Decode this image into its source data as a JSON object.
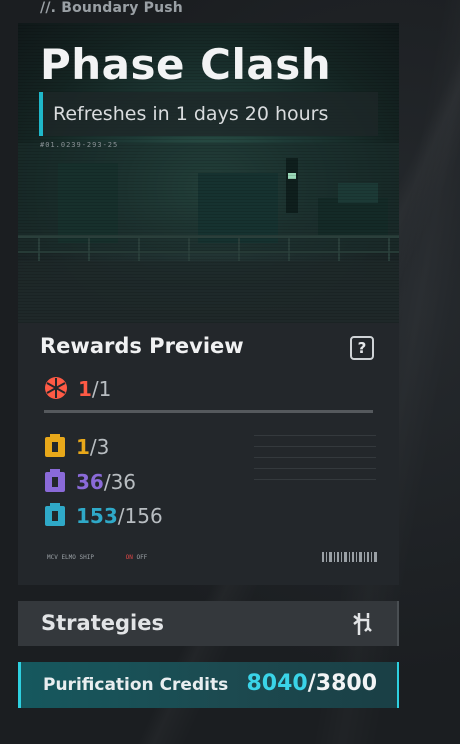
{
  "section_label": "//. Boundary Push",
  "event": {
    "title": "Phase Clash",
    "refresh_text": "Refreshes in 1 days 20 hours",
    "serial": "#01.0239-293-25"
  },
  "rewards": {
    "title": "Rewards Preview",
    "help_icon": "question-icon",
    "items": [
      {
        "icon": "orange-emblem-icon",
        "current": "1",
        "total": "/1",
        "color": "#ff5a45"
      },
      {
        "icon": "gold-chest-icon",
        "current": "1",
        "total": "/3",
        "color": "#e8a81a"
      },
      {
        "icon": "purple-chest-icon",
        "current": "36",
        "total": "/36",
        "color": "#8a6ad8"
      },
      {
        "icon": "cyan-chest-icon",
        "current": "153",
        "total": "/156",
        "color": "#2fa9c8"
      }
    ]
  },
  "footer_micro": {
    "left": "MCV ELMO SHIP",
    "on": "ON",
    "off": "OFF"
  },
  "strategies": {
    "label": "Strategies",
    "icon": "strategy-branch-icon"
  },
  "credits": {
    "label": "Purification Credits",
    "current": "8040",
    "total": "/3800"
  },
  "colors": {
    "accent": "#2ed0e0",
    "background": "#1b1e21"
  }
}
